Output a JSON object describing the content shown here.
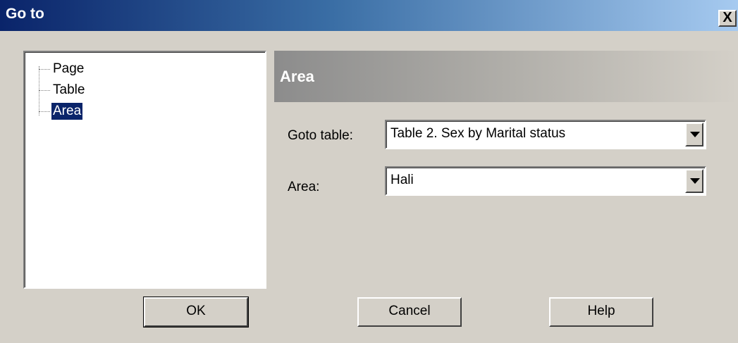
{
  "window": {
    "title": "Go to",
    "close_label": "X"
  },
  "tree": {
    "items": [
      {
        "label": "Page",
        "selected": false
      },
      {
        "label": "Table",
        "selected": false
      },
      {
        "label": "Area",
        "selected": true
      }
    ]
  },
  "panel": {
    "header": "Area",
    "goto_table_label": "Goto table:",
    "goto_table_value": "Table 2. Sex by Marital status",
    "area_label": "Area:",
    "area_value": "Hali"
  },
  "buttons": {
    "ok": "OK",
    "cancel": "Cancel",
    "help": "Help"
  },
  "colors": {
    "selection": "#0a246a",
    "dialog_bg": "#d4d0c8"
  }
}
